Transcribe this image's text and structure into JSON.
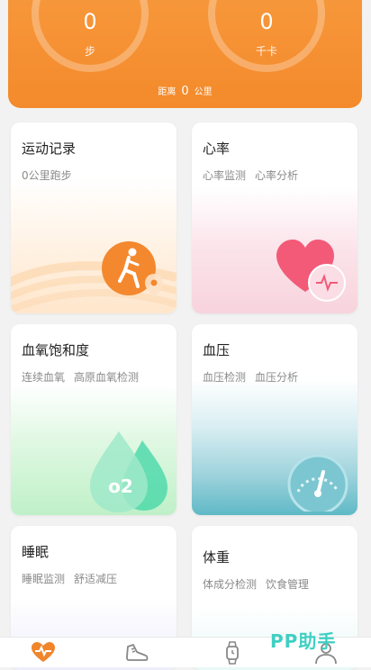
{
  "header": {
    "steps_value": "0",
    "steps_unit": "步",
    "calories_value": "0",
    "calories_unit": "千卡",
    "distance_label": "距离",
    "distance_value": "0",
    "distance_unit": "公里"
  },
  "cards": {
    "exercise": {
      "title": "运动记录",
      "subs": [
        "0公里跑步"
      ]
    },
    "heart": {
      "title": "心率",
      "subs": [
        "心率监测",
        "心率分析"
      ]
    },
    "spo2": {
      "title": "血氧饱和度",
      "subs": [
        "连续血氧",
        "高原血氧检测"
      ]
    },
    "bp": {
      "title": "血压",
      "subs": [
        "血压检测",
        "血压分析"
      ]
    },
    "sleep": {
      "title": "睡眠",
      "subs": [
        "睡眠监测",
        "舒适减压"
      ]
    },
    "weight": {
      "title": "体重",
      "subs": [
        "体成分检测",
        "饮食管理"
      ]
    }
  },
  "nav": {
    "items": [
      "heart-pulse-icon",
      "shoe-icon",
      "watch-icon",
      "person-icon"
    ],
    "active_color": "#f0852b"
  },
  "watermark": "PP助手",
  "colors": {
    "header_orange": "#f48a2b",
    "heart_red": "#f25a78",
    "drop_green": "#3fd6a6",
    "bp_teal": "#5fb9c6"
  }
}
